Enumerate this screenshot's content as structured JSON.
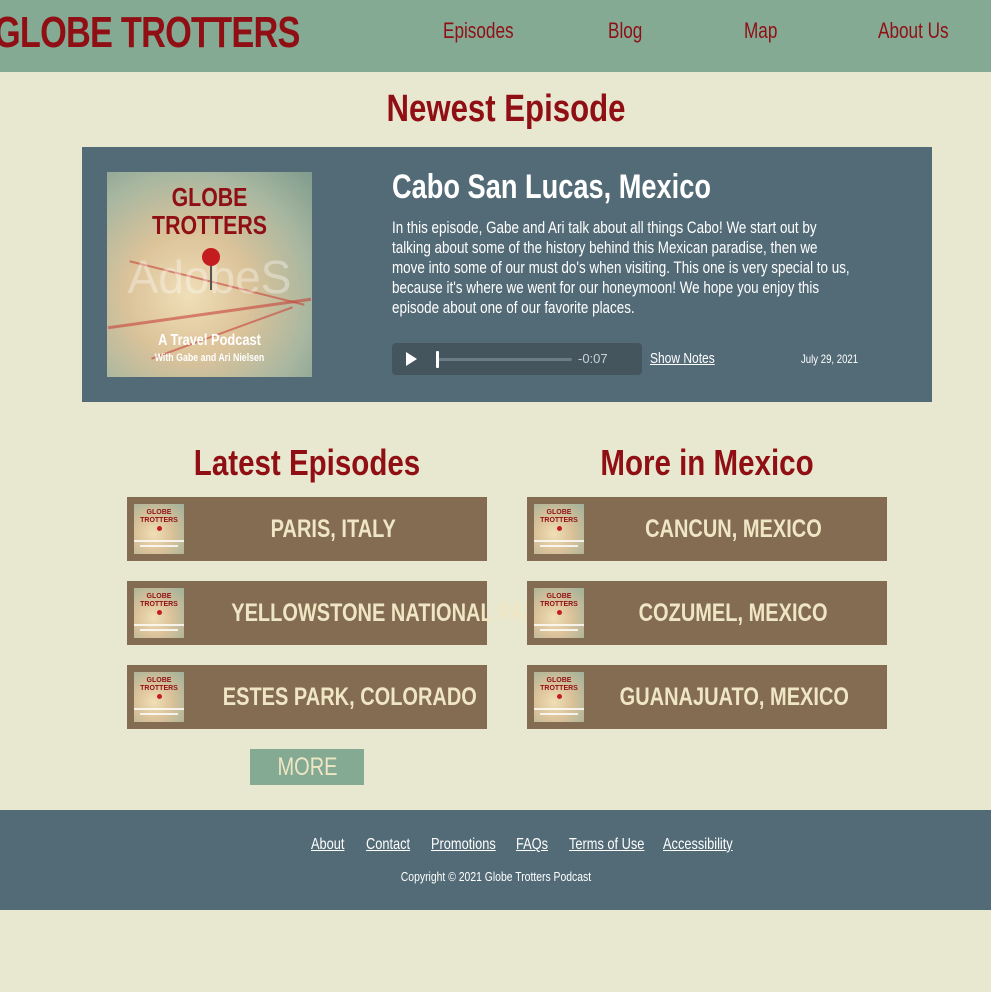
{
  "site": {
    "logo": "GLOBE TROTTERS"
  },
  "nav": {
    "items": [
      {
        "label": "Episodes"
      },
      {
        "label": "Blog"
      },
      {
        "label": "Map"
      },
      {
        "label": "About Us"
      }
    ]
  },
  "newest": {
    "section_title": "Newest Episode",
    "cover": {
      "title_line1": "GLOBE",
      "title_line2": "TROTTERS",
      "subtitle": "A Travel Podcast",
      "hosts": "With Gabe and Ari Nielsen",
      "watermark": "AdobeS"
    },
    "episode_title": "Cabo San Lucas, Mexico",
    "description": "In this episode, Gabe and Ari talk about all things Cabo! We start out by talking about some of the history behind this Mexican paradise, then we move into some of our must do's when visiting. This one is very special to us, because it's where we went for our honeymoon! We hope you enjoy this episode about one of our favorite places.",
    "player": {
      "time_remaining": "-0:07",
      "progress": 0.0
    },
    "show_notes_label": "Show Notes",
    "date": "July 29, 2021"
  },
  "latest": {
    "section_title": "Latest Episodes",
    "items": [
      {
        "label": "PARIS, ITALY"
      },
      {
        "label": "YELLOWSTONE NATIONAL PARK"
      },
      {
        "label": "ESTES PARK, COLORADO"
      }
    ],
    "more_label": "MORE"
  },
  "mexico": {
    "section_title": "More in Mexico",
    "items": [
      {
        "label": "CANCUN, MEXICO"
      },
      {
        "label": "COZUMEL, MEXICO"
      },
      {
        "label": "GUANAJUATO, MEXICO"
      }
    ]
  },
  "thumb": {
    "line1": "GLOBE",
    "line2": "TROTTERS"
  },
  "footer": {
    "links": [
      {
        "label": "About"
      },
      {
        "label": "Contact"
      },
      {
        "label": "Promotions"
      },
      {
        "label": "FAQs"
      },
      {
        "label": "Terms of Use"
      },
      {
        "label": "Accessibility"
      }
    ],
    "copyright": "Copyright © 2021 Globe Trotters Podcast"
  },
  "colors": {
    "header_bg": "#84aa94",
    "brand_red": "#8f0f15",
    "card_bg": "#536b77",
    "tile_bg": "#846c52",
    "page_bg": "#e8e7cf"
  }
}
